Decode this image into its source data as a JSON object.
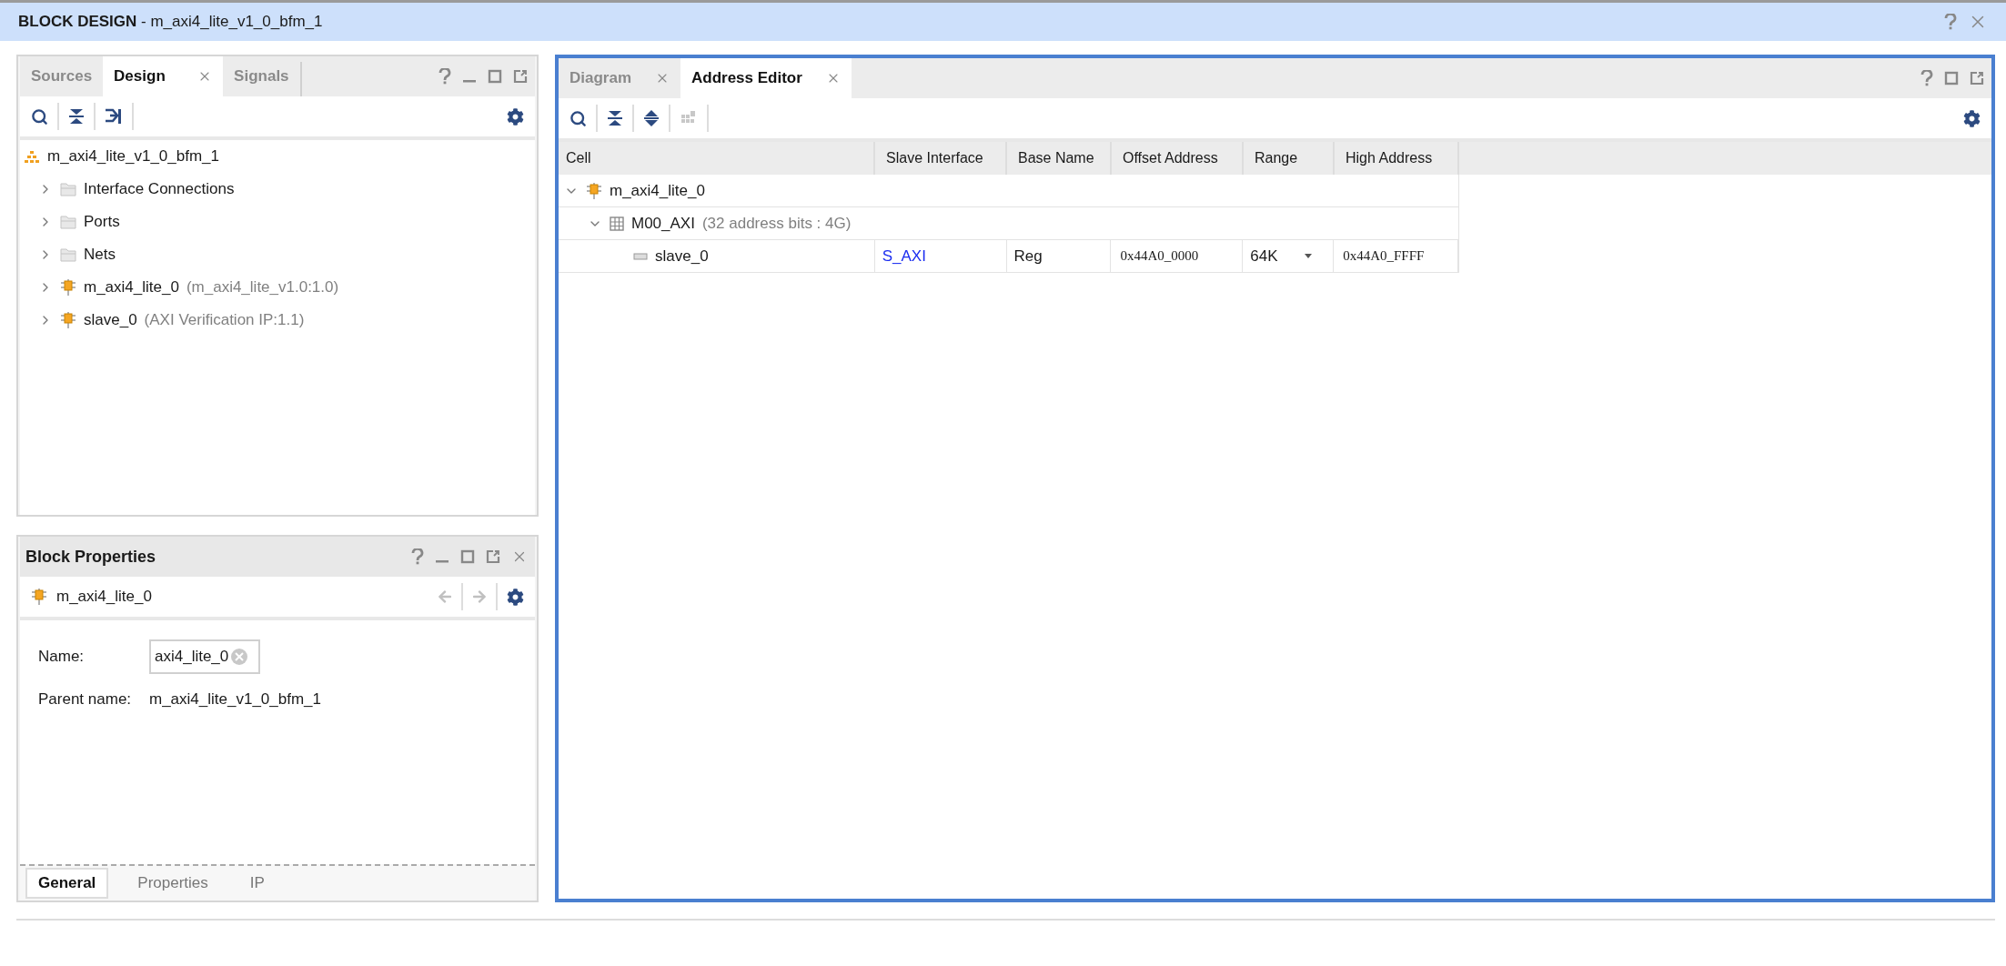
{
  "window": {
    "title": "**BLOCK DESIGN** - m_axi4_lite_v1_0_bfm_1"
  },
  "design_panel": {
    "tabs": [
      {
        "label": "Sources",
        "selected": false,
        "closable": false
      },
      {
        "label": "Design",
        "selected": true,
        "closable": true
      },
      {
        "label": "Signals",
        "selected": false,
        "closable": false
      }
    ],
    "tree": [
      {
        "kind": "design",
        "label": "m_axi4_lite_v1_0_bfm_1",
        "children": [
          {
            "kind": "folder",
            "label": "Interface Connections",
            "expanded": false
          },
          {
            "kind": "folder",
            "label": "Ports",
            "expanded": false
          },
          {
            "kind": "folder",
            "label": "Nets",
            "expanded": false
          },
          {
            "kind": "ip",
            "label": "m_axi4_lite_0",
            "detail": "(m_axi4_lite_v1.0:1.0)",
            "expanded": false
          },
          {
            "kind": "ip",
            "label": "slave_0",
            "detail": "(AXI Verification IP:1.1)",
            "expanded": false
          }
        ]
      }
    ]
  },
  "properties_panel": {
    "title": "Block Properties",
    "object": "m_axi4_lite_0",
    "fields": [
      {
        "kind": "input",
        "label": "Name:",
        "value": "axi4_lite_0"
      },
      {
        "kind": "text",
        "label": "Parent name:",
        "value": "m_axi4_lite_v1_0_bfm_1"
      }
    ],
    "tabs": [
      {
        "label": "General",
        "selected": true
      },
      {
        "label": "Properties",
        "selected": false
      },
      {
        "label": "IP",
        "selected": false
      }
    ]
  },
  "editor_panel": {
    "tabs": [
      {
        "label": "Diagram",
        "selected": false,
        "closable": true
      },
      {
        "label": "Address Editor",
        "selected": true,
        "closable": true
      }
    ],
    "table": {
      "columns": [
        "Cell",
        "Slave Interface",
        "Base Name",
        "Offset Address",
        "Range",
        "High Address"
      ],
      "rows": [
        {
          "kind": "ip",
          "label": "m_axi4_lite_0",
          "expanded": true,
          "children": [
            {
              "kind": "interface",
              "label": "M00_AXI",
              "detail": "(32 address bits : 4G)",
              "expanded": true,
              "children": [
                {
                  "kind": "segment",
                  "label": "slave_0",
                  "cells": [
                    {
                      "kind": "link",
                      "text": "S_AXI"
                    },
                    {
                      "kind": "text",
                      "text": "Reg"
                    },
                    {
                      "kind": "address",
                      "text": "0x44A0_0000"
                    },
                    {
                      "kind": "dropdown",
                      "text": "64K"
                    },
                    {
                      "kind": "address",
                      "text": "0x44A0_FFFF"
                    }
                  ]
                }
              ]
            }
          ]
        }
      ]
    }
  }
}
